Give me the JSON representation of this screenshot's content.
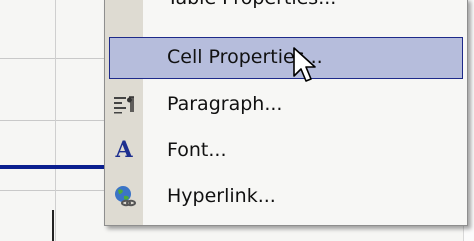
{
  "menu": {
    "items": [
      {
        "label": "Table Properties...",
        "icon": "table-properties-icon"
      },
      {
        "label": "Cell Properties...",
        "icon": "none",
        "highlighted": true
      },
      {
        "label": "Paragraph...",
        "icon": "paragraph-icon"
      },
      {
        "label": "Font...",
        "icon": "font-icon"
      },
      {
        "label": "Hyperlink...",
        "icon": "hyperlink-globe-icon"
      }
    ]
  },
  "colors": {
    "highlight_fill": "#b6bddc",
    "highlight_border": "#1e2a8a",
    "gutter": "#dedbd2",
    "blue_rule": "#0a1f8f"
  }
}
